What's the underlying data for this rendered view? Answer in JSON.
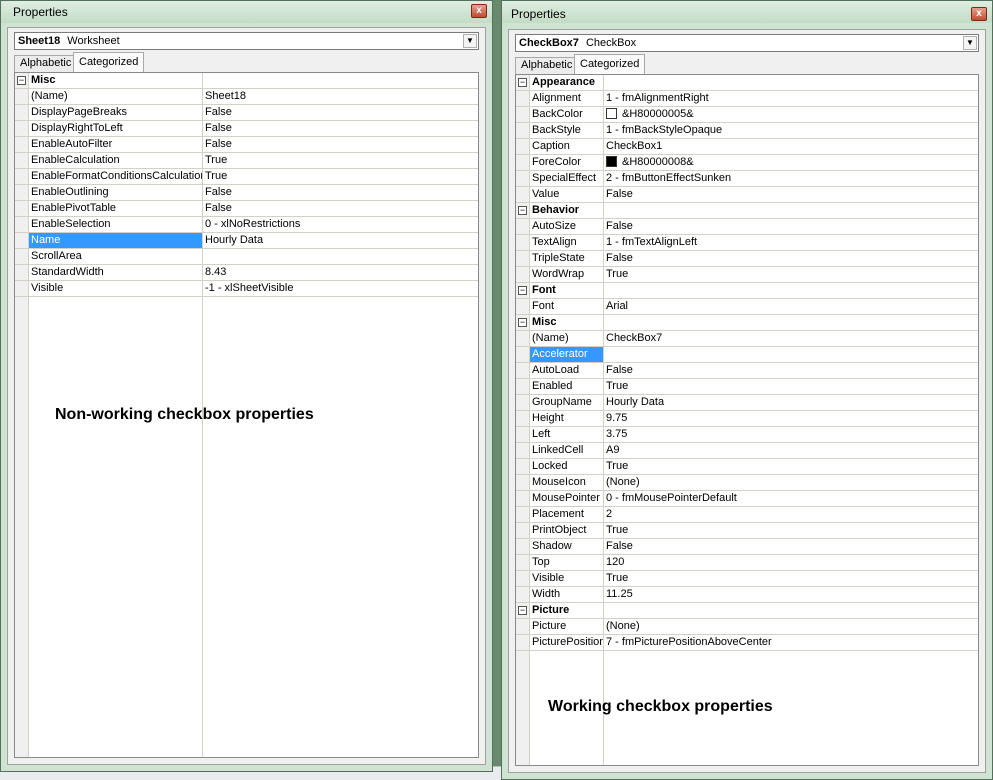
{
  "left": {
    "title": "Properties",
    "object_name": "Sheet18",
    "object_type": "Worksheet",
    "tabs": [
      "Alphabetic",
      "Categorized"
    ],
    "rows": [
      {
        "cat": true,
        "name": "Misc",
        "value": ""
      },
      {
        "name": "(Name)",
        "value": "Sheet18"
      },
      {
        "name": "DisplayPageBreaks",
        "value": "False"
      },
      {
        "name": "DisplayRightToLeft",
        "value": "False"
      },
      {
        "name": "EnableAutoFilter",
        "value": "False"
      },
      {
        "name": "EnableCalculation",
        "value": "True"
      },
      {
        "name": "EnableFormatConditionsCalculation",
        "value": "True"
      },
      {
        "name": "EnableOutlining",
        "value": "False"
      },
      {
        "name": "EnablePivotTable",
        "value": "False"
      },
      {
        "name": "EnableSelection",
        "value": "0 - xlNoRestrictions"
      },
      {
        "name": "Name",
        "value": "Hourly Data",
        "selected": true
      },
      {
        "name": "ScrollArea",
        "value": ""
      },
      {
        "name": "StandardWidth",
        "value": "8.43"
      },
      {
        "name": "Visible",
        "value": "-1 - xlSheetVisible"
      }
    ],
    "caption": "Non-working checkbox properties"
  },
  "right": {
    "title": "Properties",
    "object_name": "CheckBox7",
    "object_type": "CheckBox",
    "tabs": [
      "Alphabetic",
      "Categorized"
    ],
    "rows": [
      {
        "cat": true,
        "name": "Appearance",
        "value": ""
      },
      {
        "name": "Alignment",
        "value": "1 - fmAlignmentRight"
      },
      {
        "name": "BackColor",
        "value": "&H80000005&",
        "swatch": "#ffffff"
      },
      {
        "name": "BackStyle",
        "value": "1 - fmBackStyleOpaque"
      },
      {
        "name": "Caption",
        "value": "CheckBox1"
      },
      {
        "name": "ForeColor",
        "value": "&H80000008&",
        "swatch": "#000000"
      },
      {
        "name": "SpecialEffect",
        "value": "2 - fmButtonEffectSunken"
      },
      {
        "name": "Value",
        "value": "False"
      },
      {
        "cat": true,
        "name": "Behavior",
        "value": ""
      },
      {
        "name": "AutoSize",
        "value": "False"
      },
      {
        "name": "TextAlign",
        "value": "1 - fmTextAlignLeft"
      },
      {
        "name": "TripleState",
        "value": "False"
      },
      {
        "name": "WordWrap",
        "value": "True"
      },
      {
        "cat": true,
        "name": "Font",
        "value": ""
      },
      {
        "name": "Font",
        "value": "Arial"
      },
      {
        "cat": true,
        "name": "Misc",
        "value": ""
      },
      {
        "name": "(Name)",
        "value": "CheckBox7"
      },
      {
        "name": "Accelerator",
        "value": "",
        "selected": true
      },
      {
        "name": "AutoLoad",
        "value": "False"
      },
      {
        "name": "Enabled",
        "value": "True"
      },
      {
        "name": "GroupName",
        "value": "Hourly Data"
      },
      {
        "name": "Height",
        "value": "9.75"
      },
      {
        "name": "Left",
        "value": "3.75"
      },
      {
        "name": "LinkedCell",
        "value": "A9"
      },
      {
        "name": "Locked",
        "value": "True"
      },
      {
        "name": "MouseIcon",
        "value": "(None)"
      },
      {
        "name": "MousePointer",
        "value": "0 - fmMousePointerDefault"
      },
      {
        "name": "Placement",
        "value": "2"
      },
      {
        "name": "PrintObject",
        "value": "True"
      },
      {
        "name": "Shadow",
        "value": "False"
      },
      {
        "name": "Top",
        "value": "120"
      },
      {
        "name": "Visible",
        "value": "True"
      },
      {
        "name": "Width",
        "value": "11.25"
      },
      {
        "cat": true,
        "name": "Picture",
        "value": ""
      },
      {
        "name": "Picture",
        "value": "(None)"
      },
      {
        "name": "PicturePosition",
        "value": "7 - fmPicturePositionAboveCenter"
      }
    ],
    "caption": "Working checkbox properties"
  },
  "icons": {
    "close": "close-icon",
    "dropdown": "chevron-down-icon",
    "collapse": "minus-box-icon",
    "collapse_glyph": "−",
    "close_glyph": "x",
    "dropdown_glyph": "▼"
  },
  "colors": {
    "selection": "#3399ff",
    "window_frame": "#cfe3d2"
  }
}
